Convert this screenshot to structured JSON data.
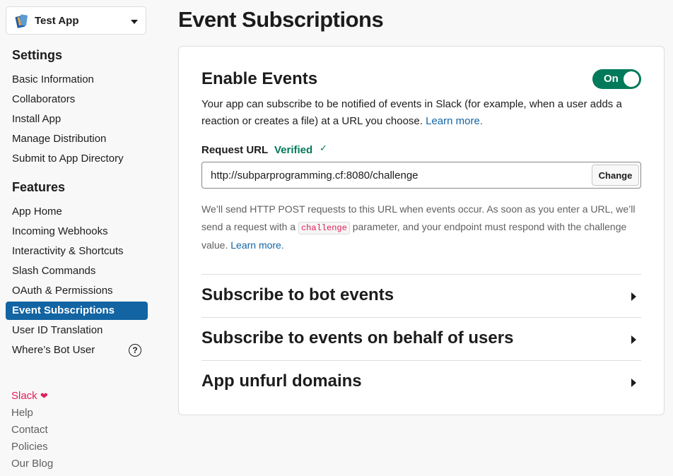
{
  "app": {
    "name": "Test App"
  },
  "sidebar": {
    "settings_title": "Settings",
    "settings_items": [
      {
        "label": "Basic Information"
      },
      {
        "label": "Collaborators"
      },
      {
        "label": "Install App"
      },
      {
        "label": "Manage Distribution"
      },
      {
        "label": "Submit to App Directory"
      }
    ],
    "features_title": "Features",
    "features_items": [
      {
        "label": "App Home"
      },
      {
        "label": "Incoming Webhooks"
      },
      {
        "label": "Interactivity & Shortcuts"
      },
      {
        "label": "Slash Commands"
      },
      {
        "label": "OAuth & Permissions"
      },
      {
        "label": "Event Subscriptions",
        "active": true
      },
      {
        "label": "User ID Translation"
      },
      {
        "label": "Where’s Bot User",
        "icon": "help-icon"
      }
    ],
    "footer": {
      "slack": "Slack",
      "heart_icon": "heart-icon",
      "links": [
        "Help",
        "Contact",
        "Policies",
        "Our Blog"
      ]
    }
  },
  "page": {
    "title": "Event Subscriptions"
  },
  "enable_events": {
    "title": "Enable Events",
    "toggle_label": "On",
    "toggle_on": true,
    "description": "Your app can subscribe to be notified of events in Slack (for example, when a user adds a reaction or creates a file) at a URL you choose.",
    "learn_more": "Learn more."
  },
  "request_url": {
    "label": "Request URL",
    "status": "Verified",
    "value": "http://subparprogramming.cf:8080/challenge",
    "change_label": "Change",
    "hint_before": "We’ll send HTTP POST requests to this URL when events occur. As soon as you enter a URL, we’ll send a request with a",
    "hint_code": "challenge",
    "hint_after": "parameter, and your endpoint must respond with the challenge value.",
    "learn_more": "Learn more."
  },
  "sections": [
    {
      "label": "Subscribe to bot events"
    },
    {
      "label": "Subscribe to events on behalf of users"
    },
    {
      "label": "App unfurl domains"
    }
  ],
  "colors": {
    "accent": "#1264a3",
    "toggle_on": "#007a5a",
    "slack_brand": "#e01e5a",
    "text": "#1d1c1d",
    "muted": "#616061"
  }
}
